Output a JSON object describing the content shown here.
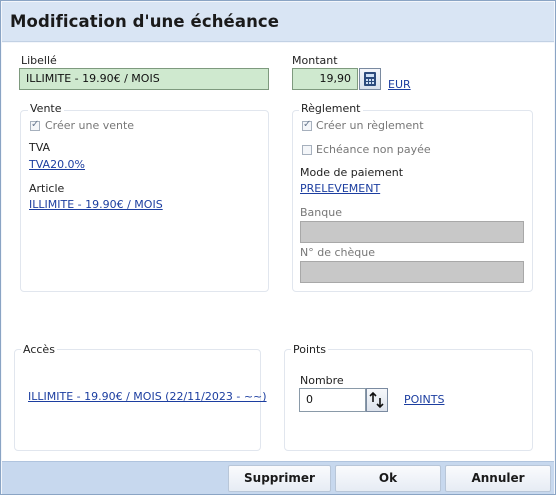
{
  "dialog": {
    "title": "Modification d'une échéance"
  },
  "libelle": {
    "label": "Libellé",
    "value": "ILLIMITE - 19.90€ / MOIS"
  },
  "montant": {
    "label": "Montant",
    "value": "19,90",
    "currency": "EUR"
  },
  "vente": {
    "title": "Vente",
    "creer_vente": {
      "label": "Créer une vente",
      "checked": true
    },
    "tva_label": "TVA",
    "tva_value": "TVA20.0%",
    "article_label": "Article",
    "article_value": "ILLIMITE - 19.90€ / MOIS"
  },
  "reglement": {
    "title": "Règlement",
    "creer_reglement": {
      "label": "Créer un règlement",
      "checked": true
    },
    "echeance_non_payee": {
      "label": "Echéance non payée",
      "checked": false
    },
    "mode_label": "Mode de paiement",
    "mode_value": "PRELEVEMENT",
    "banque_label": "Banque",
    "banque_value": "",
    "cheque_label": "N° de chèque",
    "cheque_value": ""
  },
  "acces": {
    "title": "Accès",
    "value": "ILLIMITE - 19.90€ / MOIS (22/11/2023 - ~~)"
  },
  "points": {
    "title": "Points",
    "nombre_label": "Nombre",
    "nombre_value": "0",
    "unit": "POINTS"
  },
  "footer": {
    "supprimer": "Supprimer",
    "ok": "Ok",
    "annuler": "Annuler"
  }
}
